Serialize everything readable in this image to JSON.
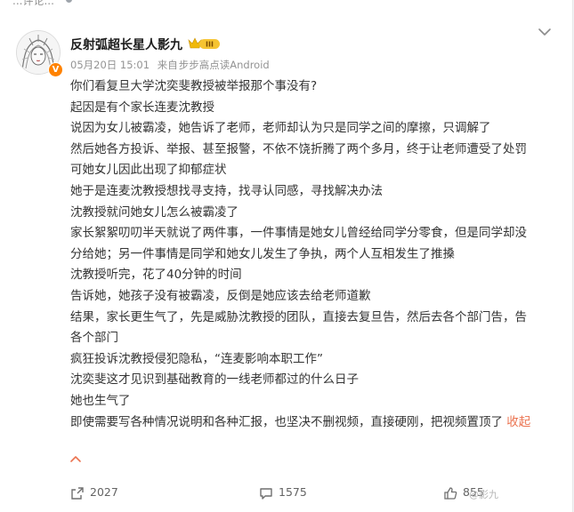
{
  "top_fragment": "...评论...",
  "author": {
    "name": "反射弧超长星人影九",
    "level_badge": "III",
    "verified_badge": "V"
  },
  "meta": {
    "date": "05月20日 15:01",
    "source_prefix": "来自",
    "source": "步步高点读Android"
  },
  "content_lines": [
    "你们看复旦大学沈奕斐教授被举报那个事没有?",
    "起因是有个家长连麦沈教授",
    "说因为女儿被霸凌，她告诉了老师，老师却认为只是同学之间的摩擦，只调解了",
    "然后她各方投诉、举报、甚至报警，不依不饶折腾了两个多月，终于让老师遭受了处罚",
    "可她女儿因此出现了抑郁症状",
    "她于是连麦沈教授想找寻支持，找寻认同感，寻找解决办法",
    "沈教授就问她女儿怎么被霸凌了",
    "家长絮絮叨叨半天就说了两件事，一件事情是她女儿曾经给同学分零食，但是同学却没",
    "分给她；另一件事情是同学和她女儿发生了争执，两个人互相发生了推搡",
    "沈教授听完，花了40分钟的时间",
    "告诉她，她孩子没有被霸凌，反倒是她应该去给老师道歉",
    "结果，家长更生气了，先是威胁沈教授的团队，直接去复旦告，然后去各个部门告，告",
    "各个部门",
    "疯狂投诉沈教授侵犯隐私，“连麦影响本职工作”",
    "沈奕斐这才见识到基础教育的一线老师都过的什么日子",
    "她也生气了",
    "即使需要写各种情况说明和各种汇报，也坚决不删视频，直接硬刚，把视频置顶了"
  ],
  "collapse_label": "收起",
  "actions": {
    "share_count": "2027",
    "comment_count": "1575",
    "like_count": "855"
  },
  "watermark": "@影九",
  "icons": {
    "more": "chevron-down-icon",
    "collapse": "chevron-up-icon",
    "share": "share-icon",
    "comment": "comment-icon",
    "like": "thumbs-up-icon"
  },
  "colors": {
    "collapse_link": "#eb7350",
    "verified": "#ff8200",
    "crown": "#f0b90b"
  }
}
